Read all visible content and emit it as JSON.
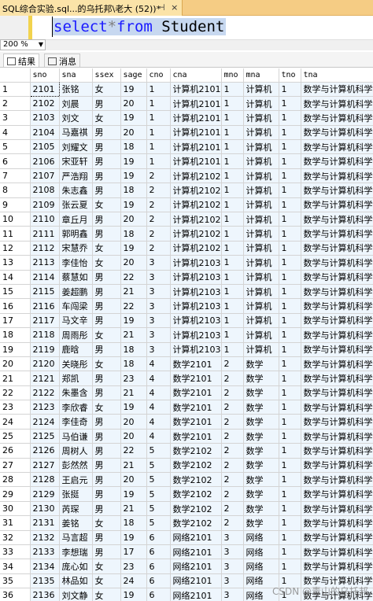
{
  "window": {
    "tab_title": "SQL综合实验.sql...的乌托邦\\老大 (52))*",
    "pin_glyph": "⊣",
    "close_glyph": "×"
  },
  "editor": {
    "kw1": "select",
    "star": "*",
    "kw2": "from",
    "table": " Student"
  },
  "zoom": {
    "level": "200 %"
  },
  "results_tabs": [
    {
      "label": "结果",
      "active": true
    },
    {
      "label": "消息",
      "active": false
    }
  ],
  "grid": {
    "columns": [
      "sno",
      "sna",
      "ssex",
      "sage",
      "cno",
      "cna",
      "mno",
      "mna",
      "tno",
      "tna"
    ],
    "rows": [
      [
        "1",
        "2101",
        "张铭",
        "女",
        "19",
        "1",
        "计算机2101",
        "1",
        "计算机",
        "1",
        "数学与计算机科学"
      ],
      [
        "2",
        "2102",
        "刘晨",
        "男",
        "20",
        "1",
        "计算机2101",
        "1",
        "计算机",
        "1",
        "数学与计算机科学"
      ],
      [
        "3",
        "2103",
        "刘文",
        "女",
        "19",
        "1",
        "计算机2101",
        "1",
        "计算机",
        "1",
        "数学与计算机科学"
      ],
      [
        "4",
        "2104",
        "马嘉祺",
        "男",
        "20",
        "1",
        "计算机2101",
        "1",
        "计算机",
        "1",
        "数学与计算机科学"
      ],
      [
        "5",
        "2105",
        "刘耀文",
        "男",
        "18",
        "1",
        "计算机2101",
        "1",
        "计算机",
        "1",
        "数学与计算机科学"
      ],
      [
        "6",
        "2106",
        "宋亚轩",
        "男",
        "19",
        "1",
        "计算机2101",
        "1",
        "计算机",
        "1",
        "数学与计算机科学"
      ],
      [
        "7",
        "2107",
        "严浩翔",
        "男",
        "19",
        "2",
        "计算机2102",
        "1",
        "计算机",
        "1",
        "数学与计算机科学"
      ],
      [
        "8",
        "2108",
        "朱志鑫",
        "男",
        "18",
        "2",
        "计算机2102",
        "1",
        "计算机",
        "1",
        "数学与计算机科学"
      ],
      [
        "9",
        "2109",
        "张云夏",
        "女",
        "19",
        "2",
        "计算机2102",
        "1",
        "计算机",
        "1",
        "数学与计算机科学"
      ],
      [
        "10",
        "2110",
        "章丘月",
        "男",
        "20",
        "2",
        "计算机2102",
        "1",
        "计算机",
        "1",
        "数学与计算机科学"
      ],
      [
        "11",
        "2111",
        "郭明鑫",
        "男",
        "18",
        "2",
        "计算机2102",
        "1",
        "计算机",
        "1",
        "数学与计算机科学"
      ],
      [
        "12",
        "2112",
        "宋慧乔",
        "女",
        "19",
        "2",
        "计算机2102",
        "1",
        "计算机",
        "1",
        "数学与计算机科学"
      ],
      [
        "13",
        "2113",
        "李佳怡",
        "女",
        "20",
        "3",
        "计算机2103",
        "1",
        "计算机",
        "1",
        "数学与计算机科学"
      ],
      [
        "14",
        "2114",
        "蔡慧如",
        "男",
        "22",
        "3",
        "计算机2103",
        "1",
        "计算机",
        "1",
        "数学与计算机科学"
      ],
      [
        "15",
        "2115",
        "姜超鹏",
        "男",
        "21",
        "3",
        "计算机2103",
        "1",
        "计算机",
        "1",
        "数学与计算机科学"
      ],
      [
        "16",
        "2116",
        "车闯梁",
        "男",
        "22",
        "3",
        "计算机2103",
        "1",
        "计算机",
        "1",
        "数学与计算机科学"
      ],
      [
        "17",
        "2117",
        "马文辛",
        "男",
        "19",
        "3",
        "计算机2103",
        "1",
        "计算机",
        "1",
        "数学与计算机科学"
      ],
      [
        "18",
        "2118",
        "周雨彤",
        "女",
        "21",
        "3",
        "计算机2103",
        "1",
        "计算机",
        "1",
        "数学与计算机科学"
      ],
      [
        "19",
        "2119",
        "鹿晗",
        "男",
        "18",
        "3",
        "计算机2103",
        "1",
        "计算机",
        "1",
        "数学与计算机科学"
      ],
      [
        "20",
        "2120",
        "关晓彤",
        "女",
        "18",
        "4",
        "数学2101",
        "2",
        "数学",
        "1",
        "数学与计算机科学"
      ],
      [
        "21",
        "2121",
        "郑凯",
        "男",
        "23",
        "4",
        "数学2101",
        "2",
        "数学",
        "1",
        "数学与计算机科学"
      ],
      [
        "22",
        "2122",
        "朱墨含",
        "男",
        "21",
        "4",
        "数学2101",
        "2",
        "数学",
        "1",
        "数学与计算机科学"
      ],
      [
        "23",
        "2123",
        "李欣睿",
        "女",
        "19",
        "4",
        "数学2101",
        "2",
        "数学",
        "1",
        "数学与计算机科学"
      ],
      [
        "24",
        "2124",
        "李佳奇",
        "男",
        "20",
        "4",
        "数学2101",
        "2",
        "数学",
        "1",
        "数学与计算机科学"
      ],
      [
        "25",
        "2125",
        "马伯谦",
        "男",
        "20",
        "4",
        "数学2101",
        "2",
        "数学",
        "1",
        "数学与计算机科学"
      ],
      [
        "26",
        "2126",
        "周树人",
        "男",
        "22",
        "5",
        "数学2102",
        "2",
        "数学",
        "1",
        "数学与计算机科学"
      ],
      [
        "27",
        "2127",
        "彭然然",
        "男",
        "21",
        "5",
        "数学2102",
        "2",
        "数学",
        "1",
        "数学与计算机科学"
      ],
      [
        "28",
        "2128",
        "王启元",
        "男",
        "20",
        "5",
        "数学2102",
        "2",
        "数学",
        "1",
        "数学与计算机科学"
      ],
      [
        "29",
        "2129",
        "张挺",
        "男",
        "19",
        "5",
        "数学2102",
        "2",
        "数学",
        "1",
        "数学与计算机科学"
      ],
      [
        "30",
        "2130",
        "芮琛",
        "男",
        "21",
        "5",
        "数学2102",
        "2",
        "数学",
        "1",
        "数学与计算机科学"
      ],
      [
        "31",
        "2131",
        "姜铭",
        "女",
        "18",
        "5",
        "数学2102",
        "2",
        "数学",
        "1",
        "数学与计算机科学"
      ],
      [
        "32",
        "2132",
        "马言超",
        "男",
        "19",
        "6",
        "网络2101",
        "3",
        "网络",
        "1",
        "数学与计算机科学"
      ],
      [
        "33",
        "2133",
        "李想瑞",
        "男",
        "17",
        "6",
        "网络2101",
        "3",
        "网络",
        "1",
        "数学与计算机科学"
      ],
      [
        "34",
        "2134",
        "庞心如",
        "女",
        "23",
        "6",
        "网络2101",
        "3",
        "网络",
        "1",
        "数学与计算机科学"
      ],
      [
        "35",
        "2135",
        "林品如",
        "女",
        "24",
        "6",
        "网络2101",
        "3",
        "网络",
        "1",
        "数学与计算机科学"
      ],
      [
        "36",
        "2136",
        "刘文静",
        "女",
        "19",
        "6",
        "网络2101",
        "3",
        "网络",
        "1",
        "数学与计算机科学"
      ]
    ]
  },
  "watermark": "CSDN @青山的乌托邦"
}
